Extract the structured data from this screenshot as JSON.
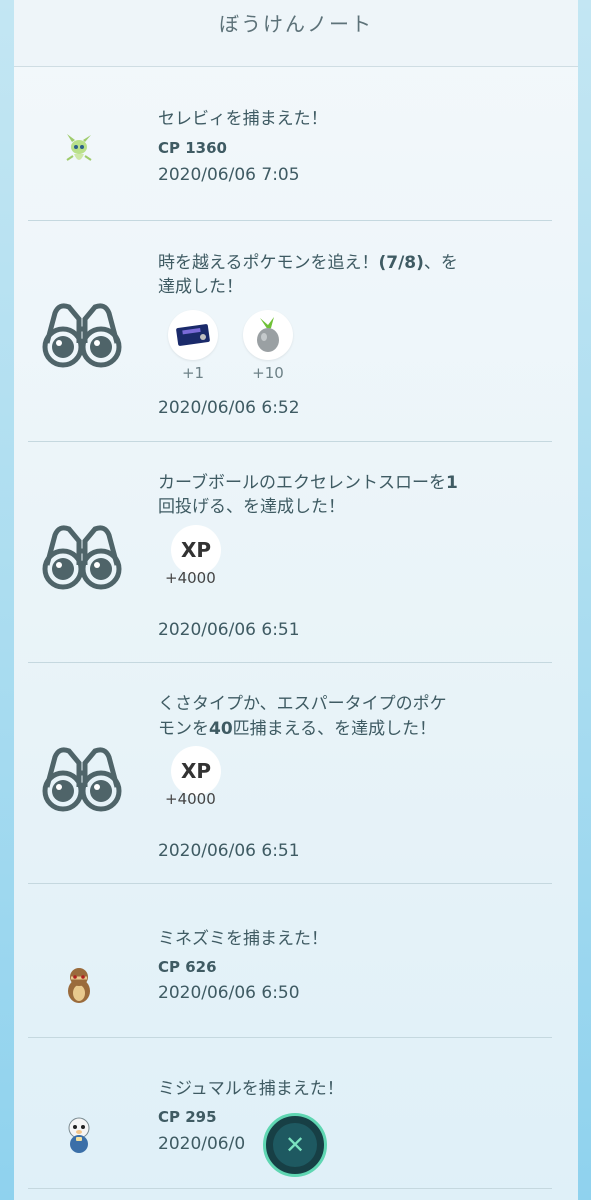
{
  "header": {
    "title": "ぼうけんノート"
  },
  "entries": [
    {
      "kind": "catch",
      "title": "セレビィを捕まえた！",
      "cp_label": "CP",
      "cp": "1360",
      "date": "2020/06/06 7:05",
      "icon": "celebi-sprite-icon"
    },
    {
      "kind": "research",
      "title_line1_pre": "時を越えるポケモンを追え！",
      "title_line1_bold": "(7/8)",
      "title_line1_post": "、を",
      "title_line2": "達成した！",
      "rewards": [
        {
          "icon": "tm-item-icon",
          "count": "+1"
        },
        {
          "icon": "pinap-berry-icon",
          "count": "+10"
        }
      ],
      "date": "2020/06/06 6:52",
      "icon": "binoculars-icon"
    },
    {
      "kind": "research",
      "title_line1_pre": "カーブボールのエクセレントスローを",
      "title_line1_bold": "1",
      "title_line2": "回投げる、を達成した！",
      "xp_label": "XP",
      "xp": "+4000",
      "date": "2020/06/06 6:51",
      "icon": "binoculars-icon"
    },
    {
      "kind": "research",
      "title_line1": "くさタイプか、エスパータイプのポケ",
      "title_line2_pre": "モンを",
      "title_line2_bold": "40",
      "title_line2_post": "匹捕まえる、を達成した！",
      "xp_label": "XP",
      "xp": "+4000",
      "date": "2020/06/06 6:51",
      "icon": "binoculars-icon"
    },
    {
      "kind": "catch",
      "title": "ミネズミを捕まえた！",
      "cp_label": "CP",
      "cp": "626",
      "date": "2020/06/06 6:50",
      "icon": "patrat-sprite-icon"
    },
    {
      "kind": "catch",
      "title": "ミジュマルを捕まえた！",
      "cp_label": "CP",
      "cp": "295",
      "date": "2020/06/0",
      "icon": "oshawott-sprite-icon"
    }
  ],
  "close_button": {
    "icon": "close-icon",
    "glyph": "✕"
  },
  "colors": {
    "text": "#3f5b63",
    "panel": "#eef5f9",
    "accent": "#5fd6b2",
    "close_bg": "#173f45"
  }
}
